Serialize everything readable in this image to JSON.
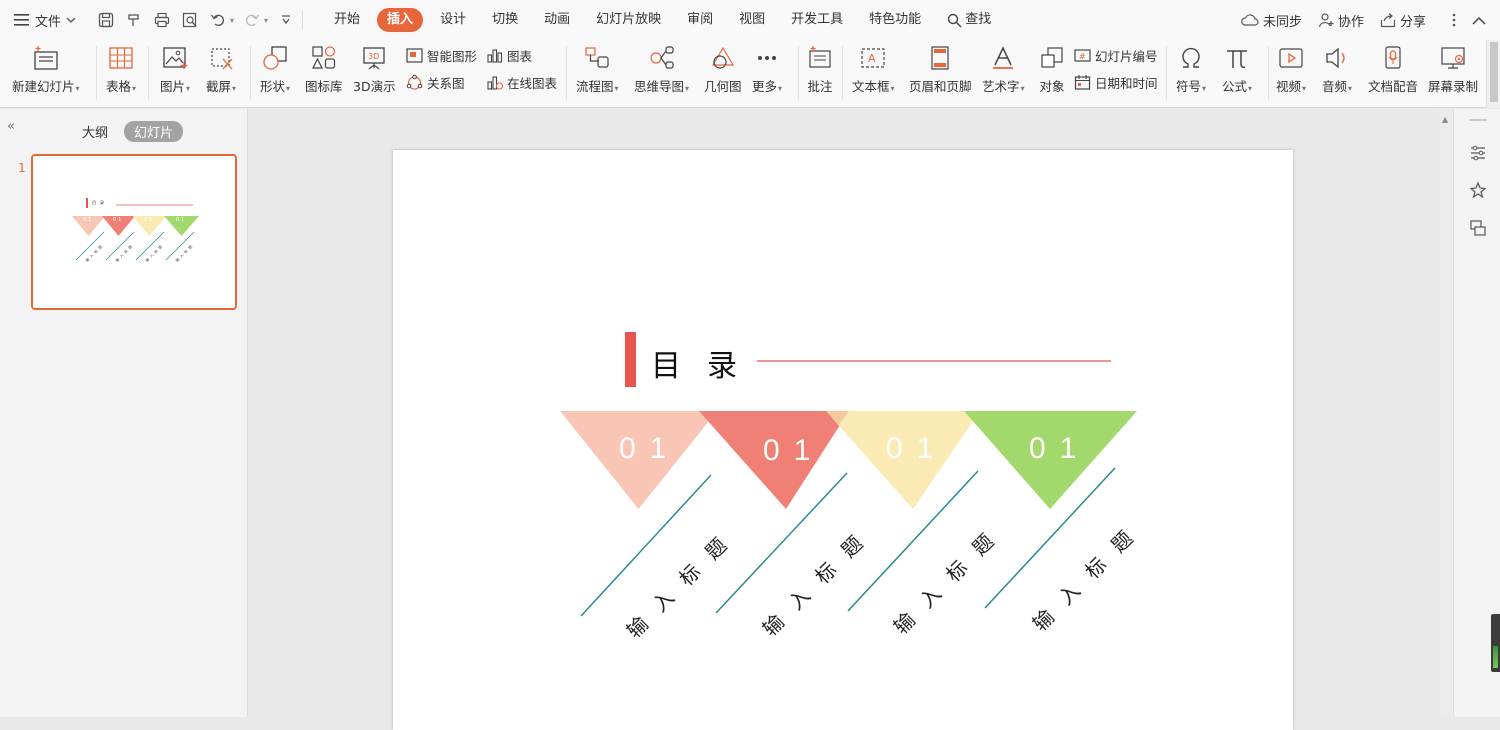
{
  "menubar": {
    "file_label": "文件",
    "tabs": [
      "开始",
      "插入",
      "设计",
      "切换",
      "动画",
      "幻灯片放映",
      "审阅",
      "视图",
      "开发工具",
      "特色功能"
    ],
    "active_tab": "插入",
    "search_label": "查找",
    "sync_label": "未同步",
    "collab_label": "协作",
    "share_label": "分享"
  },
  "ribbon": {
    "new_slide": "新建幻灯片",
    "table": "表格",
    "picture": "图片",
    "screenshot": "截屏",
    "shape": "形状",
    "icon_library": "图标库",
    "demo_3d": "3D演示",
    "smart_art": "智能图形",
    "chart": "图表",
    "relation": "关系图",
    "online_chart": "在线图表",
    "flowchart": "流程图",
    "mindmap": "思维导图",
    "geometry": "几何图",
    "more": "更多",
    "comment": "批注",
    "textbox": "文本框",
    "header_footer": "页眉和页脚",
    "wordart": "艺术字",
    "object": "对象",
    "slide_number": "幻灯片编号",
    "date_time": "日期和时间",
    "symbol": "符号",
    "formula": "公式",
    "video": "视频",
    "audio": "音频",
    "doc_voice": "文档配音",
    "screen_record": "屏幕录制"
  },
  "left_panel": {
    "tab_outline": "大纲",
    "tab_slides": "幻灯片",
    "slide_number": "1"
  },
  "slide": {
    "title": "目录",
    "items": [
      {
        "number": "01",
        "label": "输入标题",
        "color": "#f9c6b6"
      },
      {
        "number": "01",
        "label": "输入标题",
        "color": "#f07f76"
      },
      {
        "number": "01",
        "label": "输入标题",
        "color": "#faeab1"
      },
      {
        "number": "01",
        "label": "输入标题",
        "color": "#a3d86c"
      }
    ],
    "accent_color": "#e8544f",
    "line_color": "#2b8a8a"
  },
  "colors": {
    "brand": "#e8663c"
  }
}
